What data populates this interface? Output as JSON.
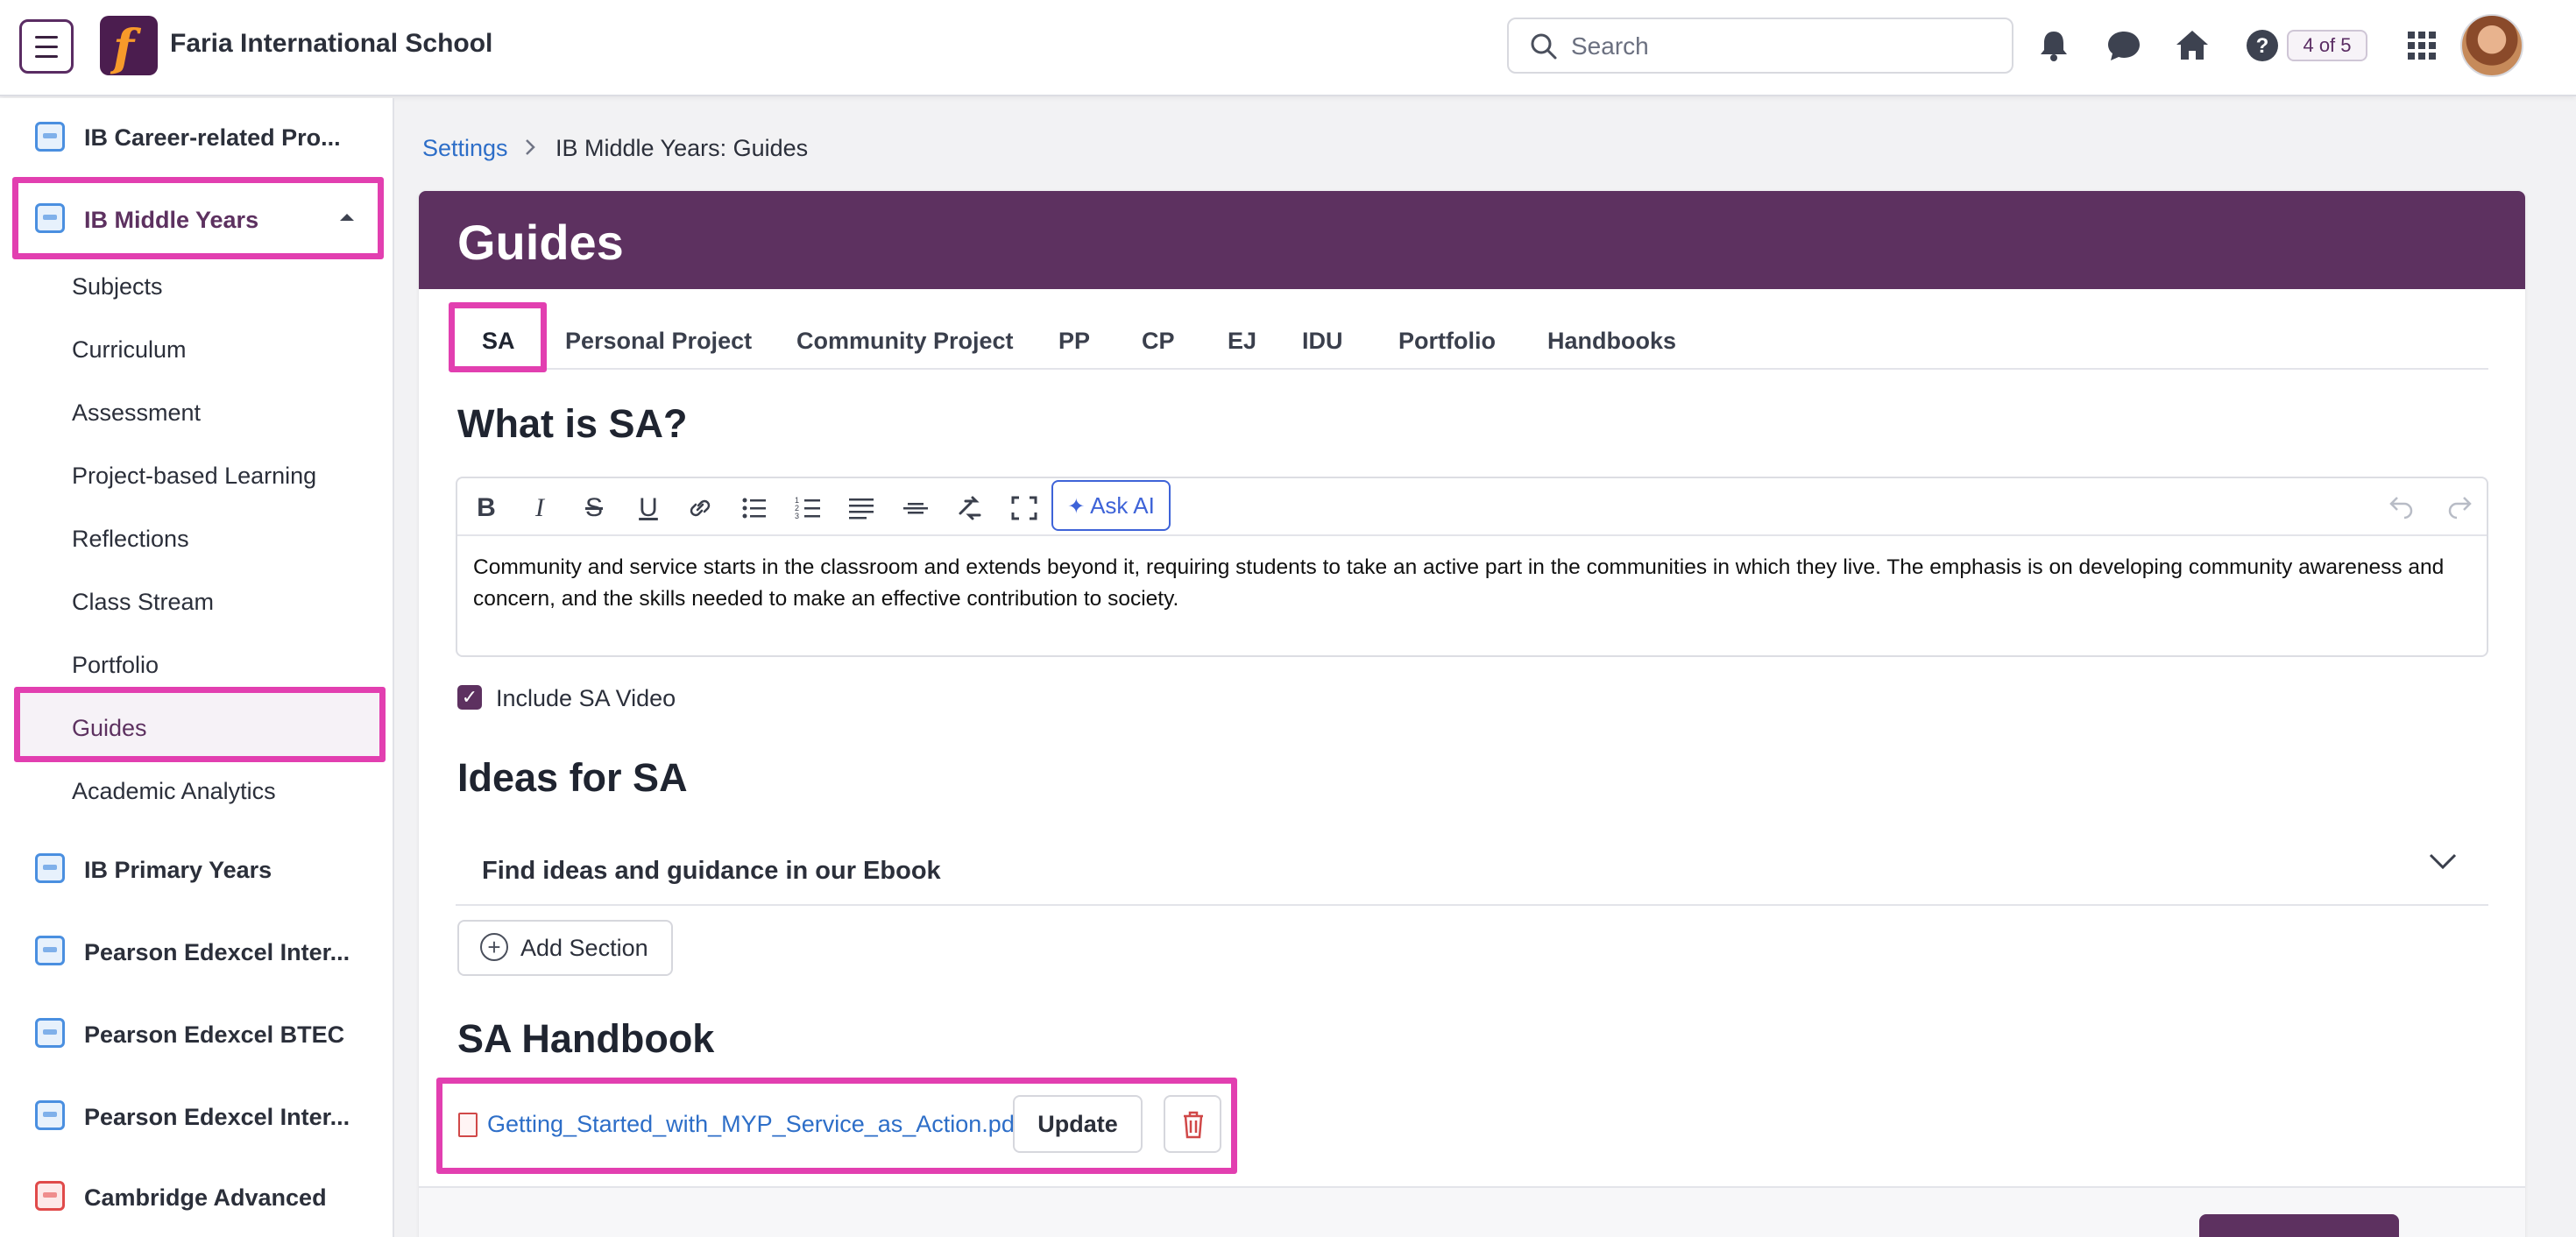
{
  "header": {
    "school_name": "Faria International School",
    "search_placeholder": "Search",
    "pager": "4 of 5",
    "icons": [
      "bell-icon",
      "chat-icon",
      "home-icon",
      "help-icon",
      "apps-grid-icon"
    ]
  },
  "sidebar": {
    "programs_top": [
      {
        "label": "IB Career-related Pro...",
        "icon": "cp-program-icon"
      }
    ],
    "active_program": {
      "label": "IB Middle Years",
      "icon": "myp-program-icon"
    },
    "sub_items": [
      "Subjects",
      "Curriculum",
      "Assessment",
      "Project-based Learning",
      "Reflections",
      "Class Stream",
      "Portfolio",
      "Guides",
      "Academic Analytics"
    ],
    "active_sub_item": "Guides",
    "programs_bottom": [
      {
        "label": "IB Primary Years",
        "icon": "pyp-program-icon"
      },
      {
        "label": "Pearson Edexcel Inter...",
        "icon": "edexcel-program-icon"
      },
      {
        "label": "Pearson Edexcel BTEC",
        "icon": "btec-program-icon"
      },
      {
        "label": "Pearson Edexcel Inter...",
        "icon": "edexcel-program-icon"
      },
      {
        "label": "Cambridge Advanced",
        "icon": "cambridge-program-icon"
      }
    ]
  },
  "breadcrumb": {
    "root": "Settings",
    "current": "IB Middle Years: Guides"
  },
  "page": {
    "title": "Guides",
    "tabs": [
      "SA",
      "Personal Project",
      "Community Project",
      "PP",
      "CP",
      "EJ",
      "IDU",
      "Portfolio",
      "Handbooks"
    ],
    "active_tab": "SA",
    "what_heading": "What is SA?",
    "editor": {
      "ask_ai_label": "Ask AI",
      "content": "Community and service starts in the classroom and extends beyond it, requiring students to take an active part in the communities in which they live. The emphasis is on developing community awareness and concern, and the skills needed to make an effective contribution to society."
    },
    "include_video": {
      "label": "Include SA Video",
      "checked": true
    },
    "ideas_heading": "Ideas for SA",
    "accordion_label": "Find ideas and guidance in our Ebook",
    "add_section_label": "Add Section",
    "handbook_heading": "SA Handbook",
    "handbook_file": "Getting_Started_with_MYP_Service_as_Action.pdf",
    "update_label": "Update"
  },
  "colors": {
    "brand": "#5d3160",
    "highlight": "#e23fb0",
    "link": "#2d6ec8",
    "ai": "#3e63d8"
  }
}
